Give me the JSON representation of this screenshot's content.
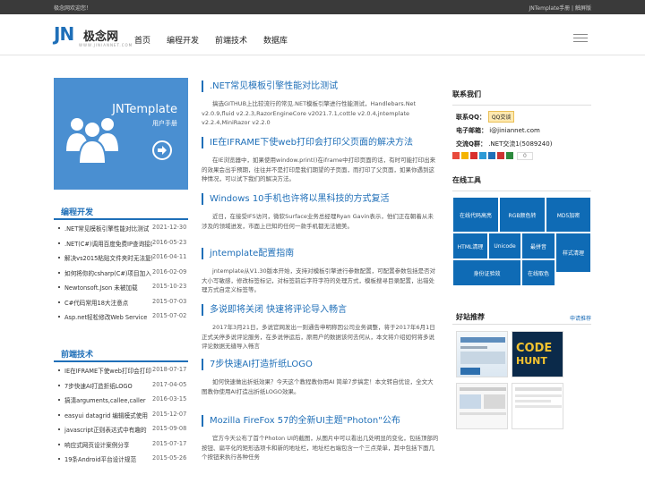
{
  "topbar": {
    "welcome": "极念网欢迎您！",
    "links": "JNTemplate手册 | 触屏版"
  },
  "logo": {
    "mark": "JN",
    "name": "极念网",
    "sub": "WWW.JINIANNET.COM"
  },
  "nav": [
    "首页",
    "编程开发",
    "前端技术",
    "数据库"
  ],
  "promo": {
    "title": "JNTemplate",
    "subtitle": "用户手册"
  },
  "sidebar": {
    "dev": {
      "title": "编程开发",
      "items": [
        {
          "title": ".NET常见模板引擎性能对比测试",
          "date": "2021-12-30"
        },
        {
          "title": ".NET(C#)调用百度免费IP查询接口",
          "date": "2016-05-23"
        },
        {
          "title": "解决vs2015粘贴文件夹时无法复制",
          "date": "2016-04-11"
        },
        {
          "title": "如何将你的csharp(C#)项目加入",
          "date": "2016-02-09"
        },
        {
          "title": "Newtonsoft.Json 未被加载",
          "date": "2015-10-23"
        },
        {
          "title": "C#代码常用18大注意点",
          "date": "2015-07-03"
        },
        {
          "title": "Asp.net轻松修改Web Service",
          "date": "2015-07-02"
        }
      ]
    },
    "frontend": {
      "title": "前端技术",
      "items": [
        {
          "title": "IE在IFRAME下使web打印会打印",
          "date": "2018-07-17"
        },
        {
          "title": "7步快速AI打造折纸LOGO",
          "date": "2017-04-05"
        },
        {
          "title": "搞清arguments,callee,caller",
          "date": "2016-03-15"
        },
        {
          "title": "easyui datagrid 编辑模式使用",
          "date": "2015-12-07"
        },
        {
          "title": "javascript正则表达式中有趣的",
          "date": "2015-09-08"
        },
        {
          "title": "响应式网页设计案例分享",
          "date": "2015-07-17"
        },
        {
          "title": "19条Android平台设计规范",
          "date": "2015-05-26"
        }
      ]
    }
  },
  "articles": [
    {
      "title": ".NET常见模板引擎性能对比测试",
      "body": "搞选GITHUB上比较流行的常见.NET模板引擎进行性能测试，Handlebars.Net v2.0.9,fluid v2.2.3,RazorEngineCore v2021.7.1,cottle v2.0.4,jntemplate v2.2.4,MiniRazor v2.2.0"
    },
    {
      "title": "IE在IFRAME下使web打印会打印父页面的解决方法",
      "body": "在IE浏览器中，如果使用window.print()在iframe中打印页面的话，有时可能打印出来的效果会出乎预期，往往并不是打印是我们期望的子页面，而打印了父页面，如果你遇到这种情况，可以试下我们的解决方法。"
    },
    {
      "title": "Windows 10手机也许将以黑科技的方式复活",
      "body": "近日，在接受IFS访问，微软Surface业务总经理Ryan Gavin表示，他们正在朝着从未涉及的领域进发，市面上已知的任何一款手机都无法媲美。"
    },
    {
      "title": "jntemplate配置指南",
      "body": "jntemplate从V1.30版本开始，支持对模板引擎进行参数配置，可配置参数包括是否对大小写敏感，修改标签标记，对标签前后字符字符的处理方式，模板搜寻目录配置，出错处理方式自定义标签等。"
    },
    {
      "title": "多说即将关闭 快速将评论导入畅言",
      "body": "2017年3月21日，多说官网发出一则通告申明称因公司业务调整，将于2017年6月1日正式关停多说评论服务，在多说停运后，原用户的数据该何去何从，本文将介绍如何将多说评论数据无缝导入畅言"
    },
    {
      "title": "7步快速AI打造折纸LOGO",
      "body": "如何快速做出折纸效果？今天这个教程教你用AI 简单7步搞定！本文转自优设，全文大图教你使用AI打造出折纸LOGO效果。"
    },
    {
      "title": "Mozilla FireFox 57的全新UI主题\"Photon\"公布",
      "body": "官方今天公布了首个Photon UI的截图，从图片中可以看出几处明显的变化，包括顶部的按钮、扁平化的矩形选项卡和新的地址栏，地址栏右端包含一个三点菜单，其中包括下面几个按钮来执行各种任务"
    }
  ],
  "contact": {
    "title": "联系我们",
    "qq_label": "联系QQ：",
    "qq_button": "QQ交谈",
    "email_label": "电子邮箱：",
    "email": "i@jiniannet.com",
    "group_label": "交流Q群：",
    "group": ".NET交流1(5089240)",
    "share_count": "0"
  },
  "tools": {
    "title": "在线工具",
    "items": [
      "在线代码高亮",
      "RGB颜色转",
      "MD5加密",
      "HTML清理",
      "Unicode",
      "最拼音",
      "样式清理",
      "身份证验效",
      "在线取色"
    ]
  },
  "friends": {
    "title": "好站推荐",
    "more": "申请推荐"
  },
  "colors": {
    "accent": "#1f6fb8",
    "tile": "#0f6bb5",
    "promo": "#4a8fd1"
  }
}
